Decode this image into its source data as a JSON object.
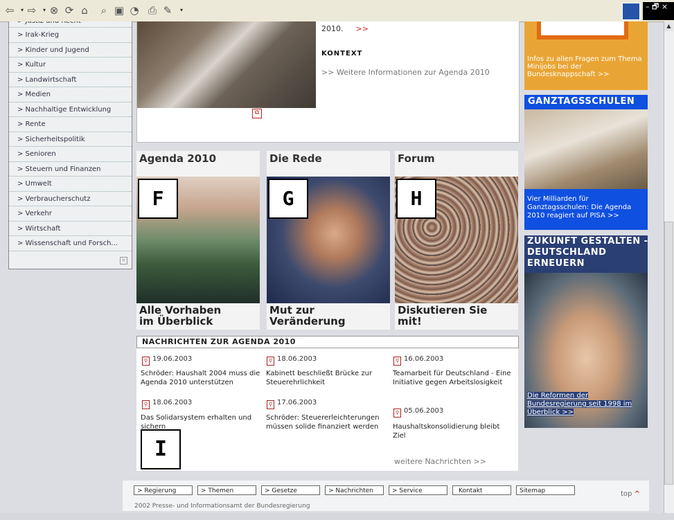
{
  "toolbar": {
    "icons": [
      "back-icon",
      "dropdown-icon",
      "forward-icon",
      "dropdown-icon",
      "stop-icon",
      "refresh-icon",
      "home-icon",
      "search-icon",
      "favorites-icon",
      "history-icon",
      "print-icon",
      "edit-icon",
      "dropdown-icon"
    ],
    "window_controls": "– 🗗 ×"
  },
  "left_menu": {
    "items": [
      "> Justiz und Recht",
      "> Irak-Krieg",
      "> Kinder und Jugend",
      "> Kultur",
      "> Landwirtschaft",
      "> Medien",
      "> Nachhaltige Entwicklung",
      "> Rente",
      "> Sicherheitspolitik",
      "> Senioren",
      "> Steuern und Finanzen",
      "> Umwelt",
      "> Verbraucherschutz",
      "> Verkehr",
      "> Wirtschaft",
      "> Wissenschaft und Forsch..."
    ]
  },
  "top_content": {
    "fragment_text": "2010.",
    "fragment_more": ">>",
    "kontext_heading": "KONTEXT",
    "kontext_link": ">> Weitere Informationen zur Agenda 2010"
  },
  "promos": [
    {
      "title": "Agenda 2010",
      "caption_1": "Alle Vorhaben",
      "caption_2": "im Überblick",
      "marker": "F"
    },
    {
      "title": "Die Rede",
      "caption_1": "Mut zur",
      "caption_2": "Veränderung",
      "marker": "G"
    },
    {
      "title": "Forum",
      "caption_1": "Diskutieren Sie",
      "caption_2": "mit!",
      "marker": "H"
    }
  ],
  "news": {
    "heading": "NACHRICHTEN ZUR AGENDA 2010",
    "items": [
      {
        "date": "19.06.2003",
        "text": "Schröder: Haushalt 2004 muss die Agenda 2010 unterstützen"
      },
      {
        "date": "18.06.2003",
        "text": "Kabinett beschließt Brücke zur Steuerehrlichkeit"
      },
      {
        "date": "16.06.2003",
        "text": "Teamarbeit für Deutschland - Eine Initiative gegen Arbeitslosigkeit"
      },
      {
        "date": "18.06.2003",
        "text": "Das Solidarsystem erhalten und sichern"
      },
      {
        "date": "17.06.2003",
        "text": "Schröder: Steuererleichterungen müssen solide finanziert werden"
      },
      {
        "date": "05.06.2003",
        "text": "Haushaltskonsolidierung bleibt Ziel"
      }
    ],
    "more_link": "weitere Nachrichten >>",
    "marker": "I"
  },
  "right_column": {
    "minijobs_text": "Infos zu allen Fragen zum Thema Minijobs bei der Bundesknappschaft >>",
    "ganztag_title": "GANZTAGSSCHULEN",
    "ganztag_text": "Vier Milliarden für Ganztagsschulen: Die Agenda 2010 reagiert auf PISA >>",
    "zukunft_title": "ZUKUNFT GESTALTEN - DEUTSCHLAND ERNEUERN",
    "zukunft_text": "Die Reformen der Bundesregierung seit 1998 im Überblick >>"
  },
  "footer": {
    "buttons": [
      "> Regierung",
      "> Themen",
      "> Gesetze",
      "> Nachrichten",
      "> Service",
      "Kontakt",
      "Sitemap"
    ],
    "copyright": "2002 Presse- und Informationsamt der Bundesregierung",
    "top_link": "top",
    "top_arrow": "^"
  }
}
